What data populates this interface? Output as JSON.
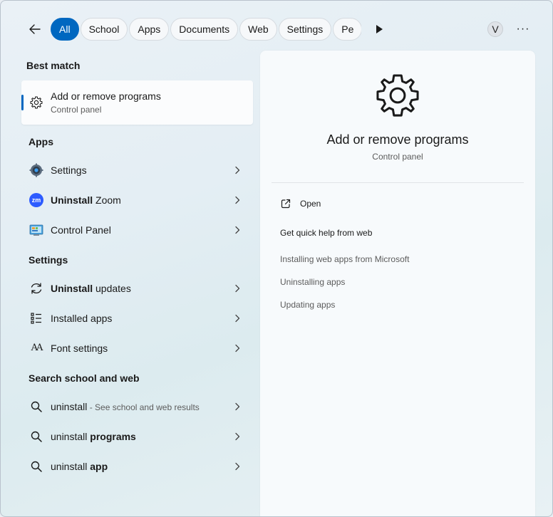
{
  "colors": {
    "accent": "#0067c0",
    "zoom_brand": "#2d5bff"
  },
  "filters": [
    "All",
    "School",
    "Apps",
    "Documents",
    "Web",
    "Settings",
    "Pe"
  ],
  "avatar": {
    "initial": "V"
  },
  "menu": {
    "dots": "···"
  },
  "best_match": {
    "heading": "Best match",
    "title": "Add or remove programs",
    "subtitle": "Control panel",
    "icon": "gear-icon"
  },
  "apps": {
    "heading": "Apps",
    "items": [
      {
        "icon": "settings-app-icon",
        "bold": "",
        "rest": "Settings"
      },
      {
        "icon": "zoom-app-icon",
        "bold": "Uninstall",
        "rest": " Zoom",
        "icon_text": "zm"
      },
      {
        "icon": "control-panel-icon",
        "bold": "",
        "rest": "Control Panel"
      }
    ]
  },
  "settings": {
    "heading": "Settings",
    "items": [
      {
        "icon": "refresh-icon",
        "bold": "Uninstall",
        "rest": " updates"
      },
      {
        "icon": "list-icon",
        "bold": "",
        "rest": "Installed apps"
      },
      {
        "icon": "font-icon",
        "bold": "",
        "rest": "Font settings",
        "icon_text": "AΑ"
      }
    ]
  },
  "web": {
    "heading": "Search school and web",
    "items": [
      {
        "icon": "search-icon",
        "plain": "uninstall",
        "bold": "",
        "muted": " - See school and web results"
      },
      {
        "icon": "search-icon",
        "plain": "uninstall ",
        "bold": "programs",
        "muted": ""
      },
      {
        "icon": "search-icon",
        "plain": "uninstall ",
        "bold": "app",
        "muted": ""
      }
    ]
  },
  "detail": {
    "title": "Add or remove programs",
    "subtitle": "Control panel",
    "open_label": "Open",
    "help_title": "Get quick help from web",
    "links": [
      "Installing web apps from Microsoft",
      "Uninstalling apps",
      "Updating apps"
    ]
  }
}
